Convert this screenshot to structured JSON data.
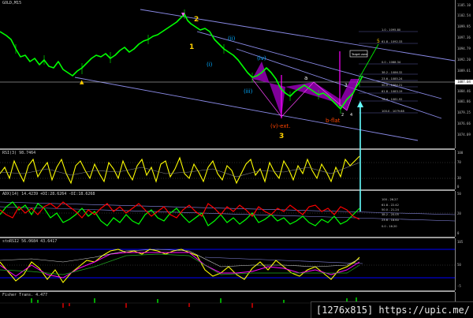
{
  "panes": {
    "main": {
      "title": "GOLD,M15",
      "wave_labels": {
        "w2": "2",
        "w1": "1",
        "wi": "(i)",
        "wii": "(ii)",
        "wiii": "(iii)",
        "wiv": "(iv)",
        "w3": "3",
        "w5": "5",
        "wa": "a",
        "w3b": "3",
        "w4b": "4",
        "w2b": "2",
        "vext": "(v)-ext.",
        "bflat": "b-flat"
      },
      "price_scale": [
        "1105.10",
        "1102.54",
        "1099.95",
        "1097.36",
        "1094.79",
        "1092.20",
        "1089.61",
        "1087.04",
        "1084.46",
        "1081.86",
        "1079.25",
        "1076.66",
        "1074.09"
      ],
      "current_price": "1087.04",
      "target_label": "Target zone",
      "fib_levels": [
        "1.0 - 1095.80",
        "61.8 - 1092.33",
        "0.0 - 1088.34",
        "38.2 - 1086.32",
        "23.6 - 1085.24",
        "50.0 - 1084.21",
        "61.8 - 1083.19",
        "76.4 - 1081.92",
        "100.0 - 1079.68"
      ],
      "left_fib_levels": [
        "100 - 1100.43",
        "61.8 - 1098.36"
      ]
    },
    "rsi": {
      "title": "RSI(3) 98.7464",
      "scale": [
        "100",
        "70",
        "30",
        "0"
      ]
    },
    "adx": {
      "title": "ADX(14) 14.4239 +DI:28.6264 -DI:18.6268",
      "scale": [
        "50",
        "20",
        "0"
      ],
      "fib_levels": [
        "100 - 26.27",
        "61.8 - 22.42",
        "50.0 - 21.24",
        "38.2 - 20.05",
        "23.6 - 18.60",
        "0.0 - 16.20"
      ]
    },
    "stoch": {
      "title": "stoRSI2 56.0684 43.6417",
      "scale": [
        "105",
        "50",
        "-5"
      ]
    },
    "bottom": {
      "title": "Fisher Trans. 4.477"
    }
  },
  "badge": "[1276x815] https://upic.me/",
  "colors": {
    "bull_candle": "#00ff00",
    "bear_candle": "#00ff00",
    "channel": "#8a8ae6",
    "pattern": "#cc00cc",
    "rsi": "#ffff00",
    "adx_plus": "#00ff00",
    "adx_minus": "#ff0000",
    "cyan_arrow": "#66ffff"
  }
}
